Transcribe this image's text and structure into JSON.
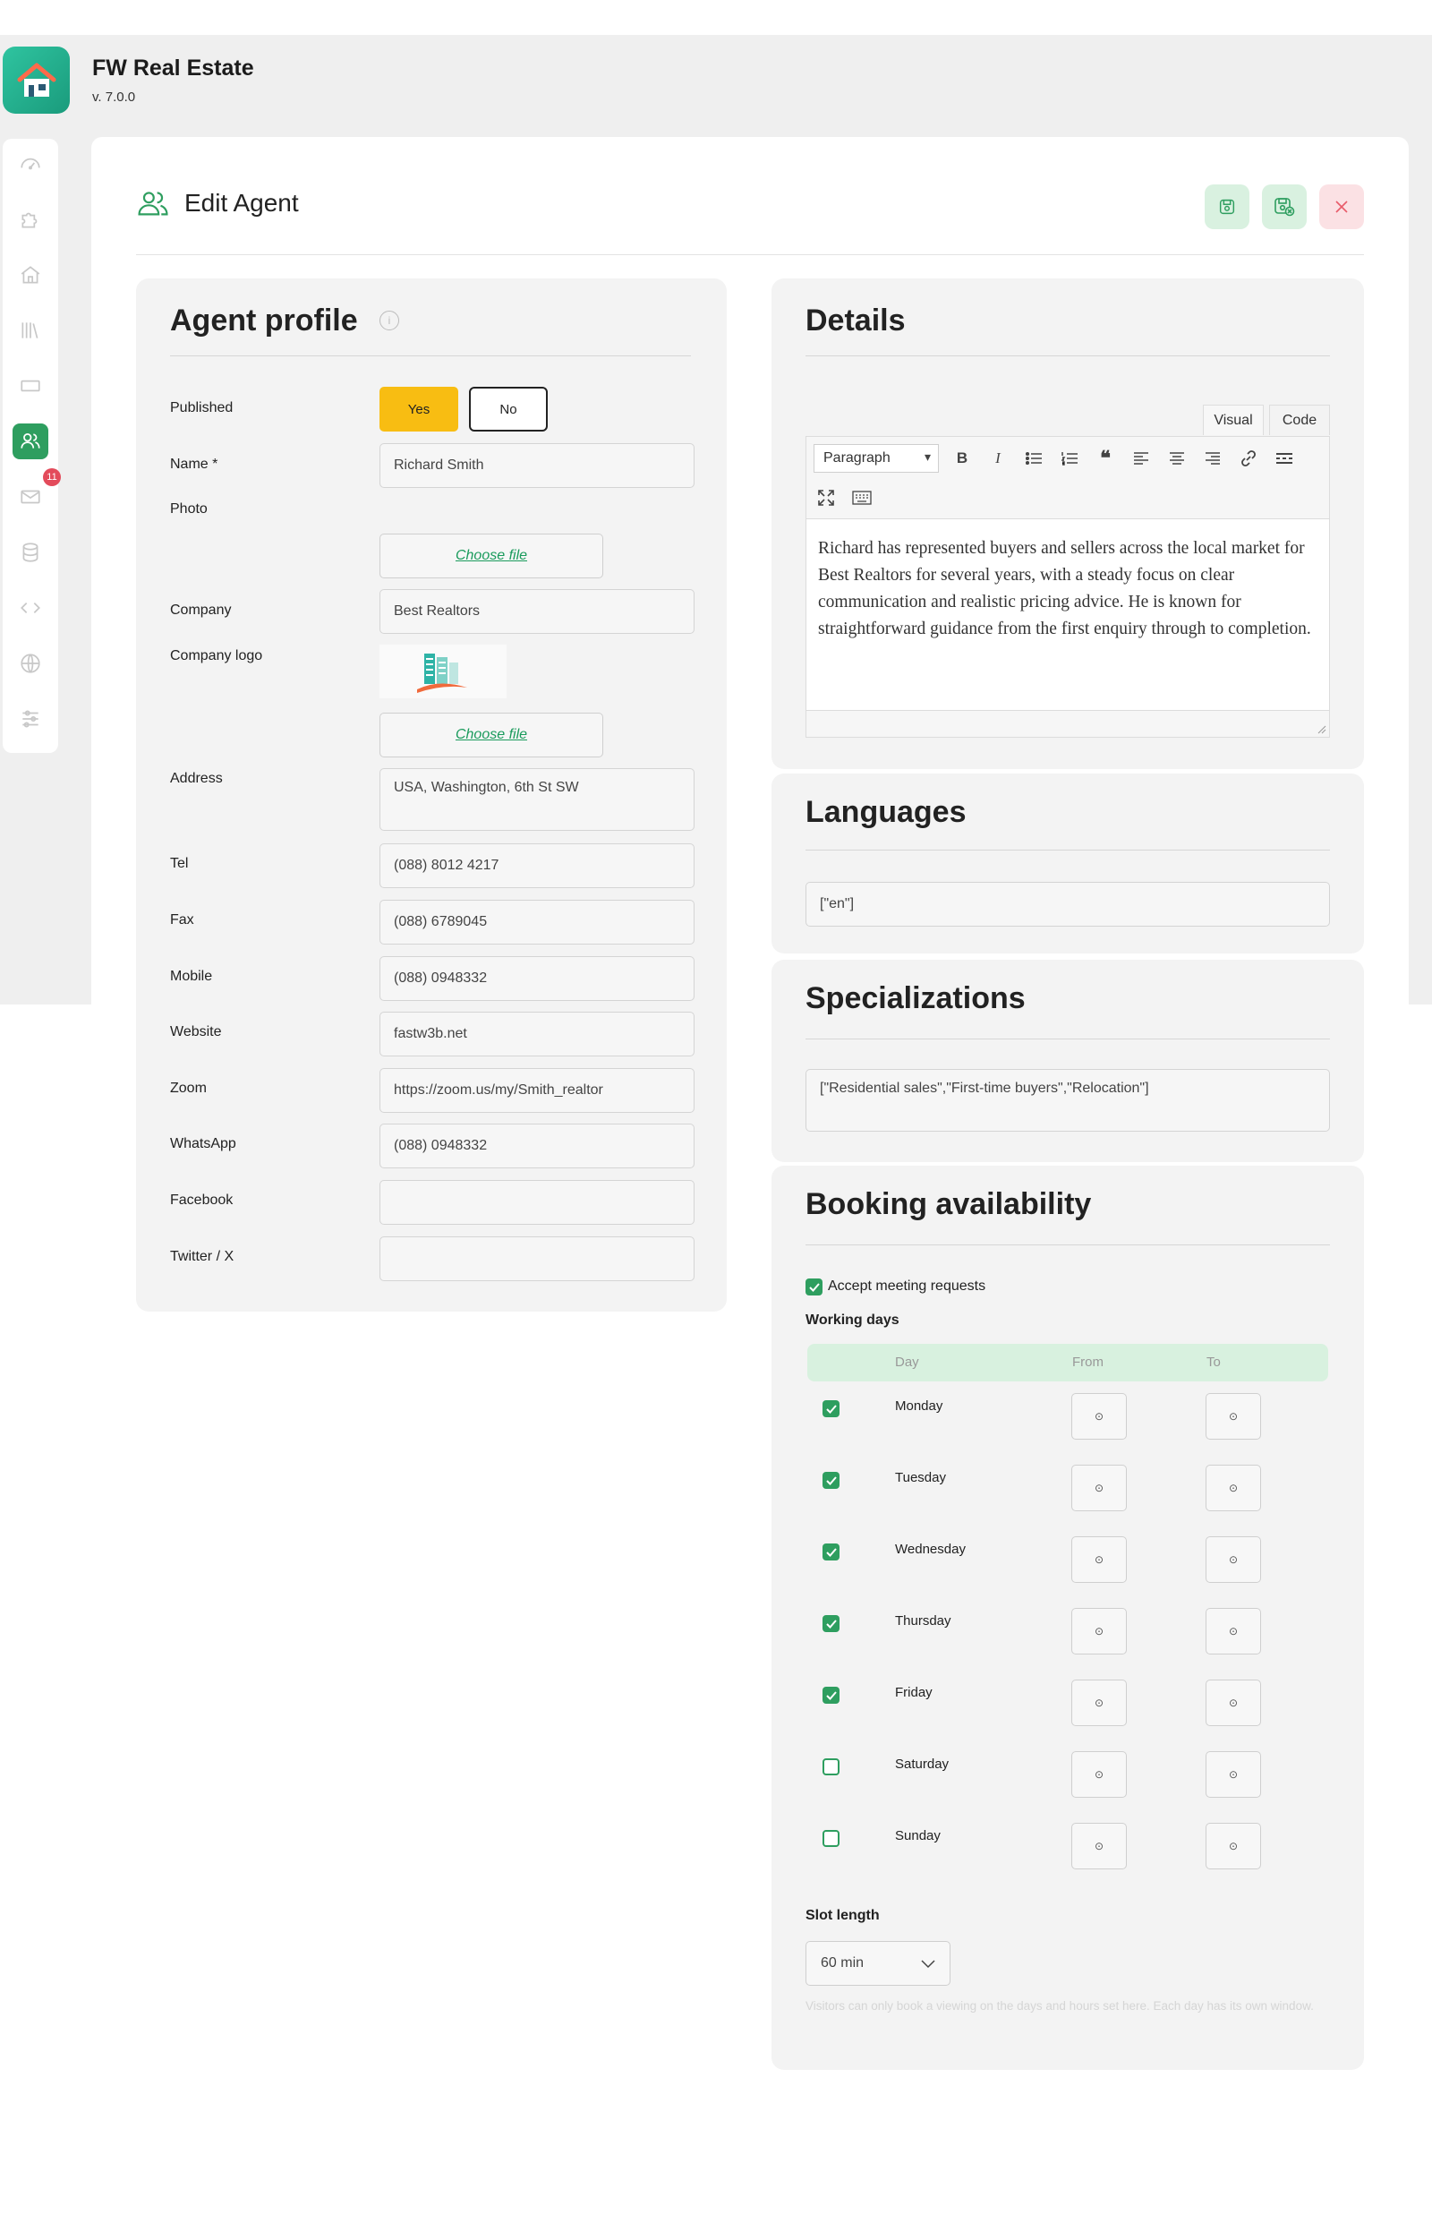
{
  "app": {
    "title": "FW Real Estate",
    "version": "v. 7.0.0",
    "brand_color": "#1a9b7c"
  },
  "sidebar": {
    "items": [
      {
        "icon": "dashboard-icon"
      },
      {
        "icon": "puzzle-icon"
      },
      {
        "icon": "home-icon"
      },
      {
        "icon": "library-icon"
      },
      {
        "icon": "card-icon"
      },
      {
        "icon": "users-icon",
        "active": true
      },
      {
        "icon": "mail-icon",
        "badge": "11"
      },
      {
        "icon": "database-icon"
      },
      {
        "icon": "code-icon"
      },
      {
        "icon": "globe-icon"
      },
      {
        "icon": "sliders-icon"
      }
    ]
  },
  "header": {
    "title": "Edit Agent",
    "icon": "users-icon",
    "buttons": [
      "save-icon",
      "save-and-close-icon",
      "close-icon"
    ]
  },
  "profile": {
    "title": "Agent profile",
    "published_label": "Published",
    "yes_label": "Yes",
    "no_label": "No",
    "name_label": "Name *",
    "name_value": "Richard Smith",
    "photo_label": "Photo",
    "choose_file": "Choose file",
    "company_label": "Company",
    "company_value": "Best Realtors",
    "company_logo_label": "Company logo",
    "address_label": "Address",
    "address_value": "USA, Washington, 6th St SW",
    "tel_label": "Tel",
    "tel_value": "(088) 8012 4217",
    "fax_label": "Fax",
    "fax_value": "(088) 6789045",
    "mobile_label": "Mobile",
    "mobile_value": "(088) 0948332",
    "website_label": "Website",
    "website_value": "fastw3b.net",
    "zoom_label": "Zoom",
    "zoom_value": "https://zoom.us/my/Smith_realtor",
    "whatsapp_label": "WhatsApp",
    "whatsapp_value": "(088) 0948332",
    "facebook_label": "Facebook",
    "facebook_value": "",
    "twitter_label": "Twitter / X",
    "twitter_value": ""
  },
  "details": {
    "title": "Details",
    "tab_visual": "Visual",
    "tab_code": "Code",
    "format_select": "Paragraph",
    "body": "Richard has represented buyers and sellers across the local market for Best Realtors for several years, with a steady focus on clear communication and realistic pricing advice. He is known for straightforward guidance from the first enquiry through to completion."
  },
  "languages": {
    "title": "Languages",
    "value": "[\"en\"]"
  },
  "specializations": {
    "title": "Specializations",
    "value": "[\"Residential sales\",\"First-time buyers\",\"Relocation\"]"
  },
  "booking": {
    "title": "Booking availability",
    "accept_label": "Accept meeting requests",
    "accept_checked": true,
    "working_days_label": "Working days",
    "col_day": "Day",
    "col_from": "From",
    "col_to": "To",
    "time_placeholder": "⊙",
    "days": [
      {
        "name": "Monday",
        "checked": true
      },
      {
        "name": "Tuesday",
        "checked": true
      },
      {
        "name": "Wednesday",
        "checked": true
      },
      {
        "name": "Thursday",
        "checked": true
      },
      {
        "name": "Friday",
        "checked": true
      },
      {
        "name": "Saturday",
        "checked": false
      },
      {
        "name": "Sunday",
        "checked": false
      }
    ],
    "slot_length_label": "Slot length",
    "slot_length_value": "60 min",
    "help_text": "Visitors can only book a viewing on the days and hours set here. Each day has its own window."
  },
  "colors": {
    "accent_green": "#2e9e5f",
    "yes_button": "#f8bd12",
    "badge_red": "#e34b5b",
    "close_red": "#e85b6a"
  }
}
